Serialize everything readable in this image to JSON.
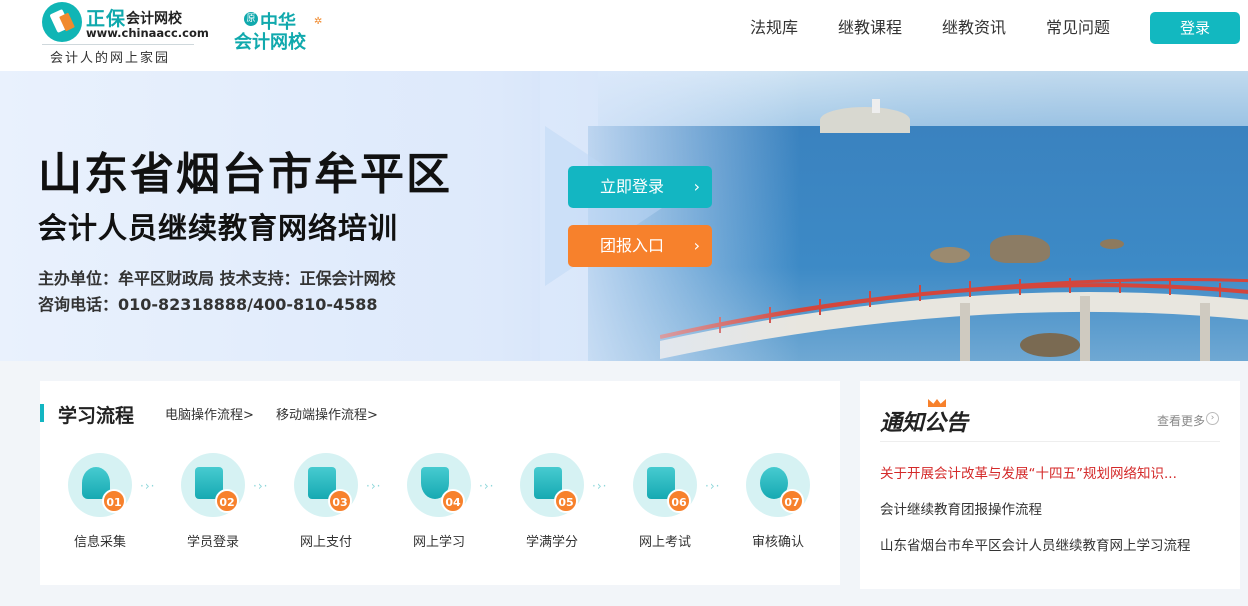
{
  "header": {
    "logo": {
      "brand_zb": "正保",
      "brand_kj": "会计网校",
      "url": "www.chinaacc.com",
      "slogan": "会计人的网上家园"
    },
    "logo2": {
      "badge": "原",
      "line1": "中华",
      "line2": "会计网校"
    },
    "nav": [
      "法规库",
      "继教课程",
      "继教资讯",
      "常见问题"
    ],
    "login_label": "登录"
  },
  "banner": {
    "title": "山东省烟台市牟平区",
    "subtitle": "会计人员继续教育网络培训",
    "info_host": "主办单位：牟平区财政局  技术支持：正保会计网校",
    "info_phone": "咨询电话：010-82318888/400-810-4588",
    "btn_login": "立即登录",
    "btn_group": "团报入口",
    "arrow": "›"
  },
  "flow": {
    "title": "学习流程",
    "link_pc": "电脑操作流程>",
    "link_mobile": "移动端操作流程>",
    "steps": [
      {
        "num": "01",
        "label": "信息采集",
        "icon": "user-icon"
      },
      {
        "num": "02",
        "label": "学员登录",
        "icon": "document-icon"
      },
      {
        "num": "03",
        "label": "网上支付",
        "icon": "calendar-icon"
      },
      {
        "num": "04",
        "label": "网上学习",
        "icon": "shield-check-icon"
      },
      {
        "num": "05",
        "label": "学满学分",
        "icon": "edit-icon"
      },
      {
        "num": "06",
        "label": "网上考试",
        "icon": "exam-check-icon"
      },
      {
        "num": "07",
        "label": "审核确认",
        "icon": "ring-icon"
      }
    ],
    "arrow": "·›·"
  },
  "notice": {
    "title": "通知公告",
    "more": "查看更多",
    "items": [
      "关于开展会计改革与发展“十四五”规划网络知识...",
      "会计继续教育团报操作流程",
      "山东省烟台市牟平区会计人员继续教育网上学习流程"
    ]
  },
  "colors": {
    "accent": "#13b6c2",
    "orange": "#f7812c",
    "hot": "#d42a2a"
  }
}
